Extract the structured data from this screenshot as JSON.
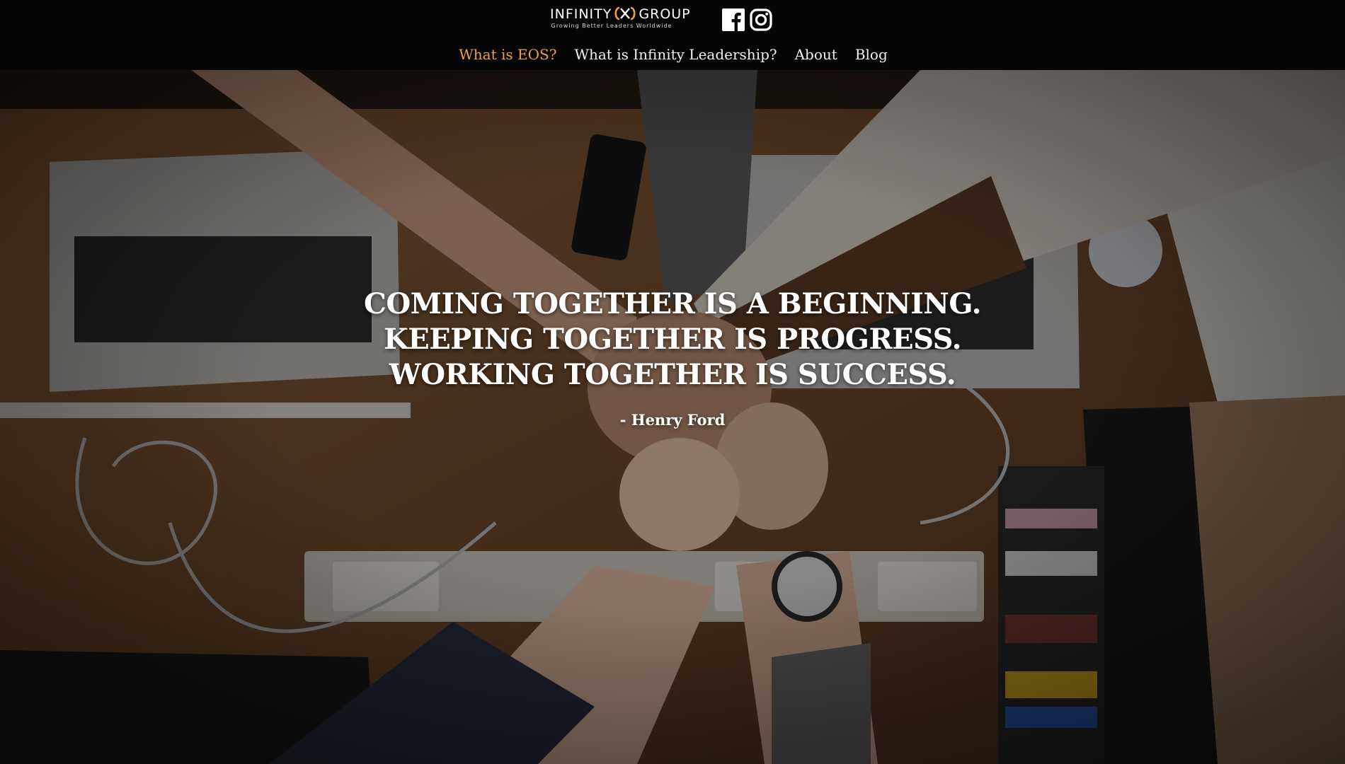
{
  "header": {
    "logo": {
      "name_left": "INFINITY",
      "name_right": "GROUP",
      "tagline": "Growing Better Leaders Worldwide"
    },
    "social": [
      {
        "icon": "facebook-icon"
      },
      {
        "icon": "instagram-icon"
      }
    ],
    "nav": [
      {
        "label": "What is EOS?",
        "active": true
      },
      {
        "label": "What is Infinity Leadership?",
        "active": false
      },
      {
        "label": "About",
        "active": false
      },
      {
        "label": "Blog",
        "active": false
      }
    ]
  },
  "hero": {
    "quote_lines": [
      "COMING TOGETHER IS A BEGINNING.",
      "KEEPING TOGETHER IS PROGRESS.",
      "WORKING TOGETHER IS SUCCESS."
    ],
    "author": "- Henry Ford"
  },
  "colors": {
    "header_bg": "#050505",
    "accent": "#e9a23f",
    "text": "#ffffff"
  }
}
